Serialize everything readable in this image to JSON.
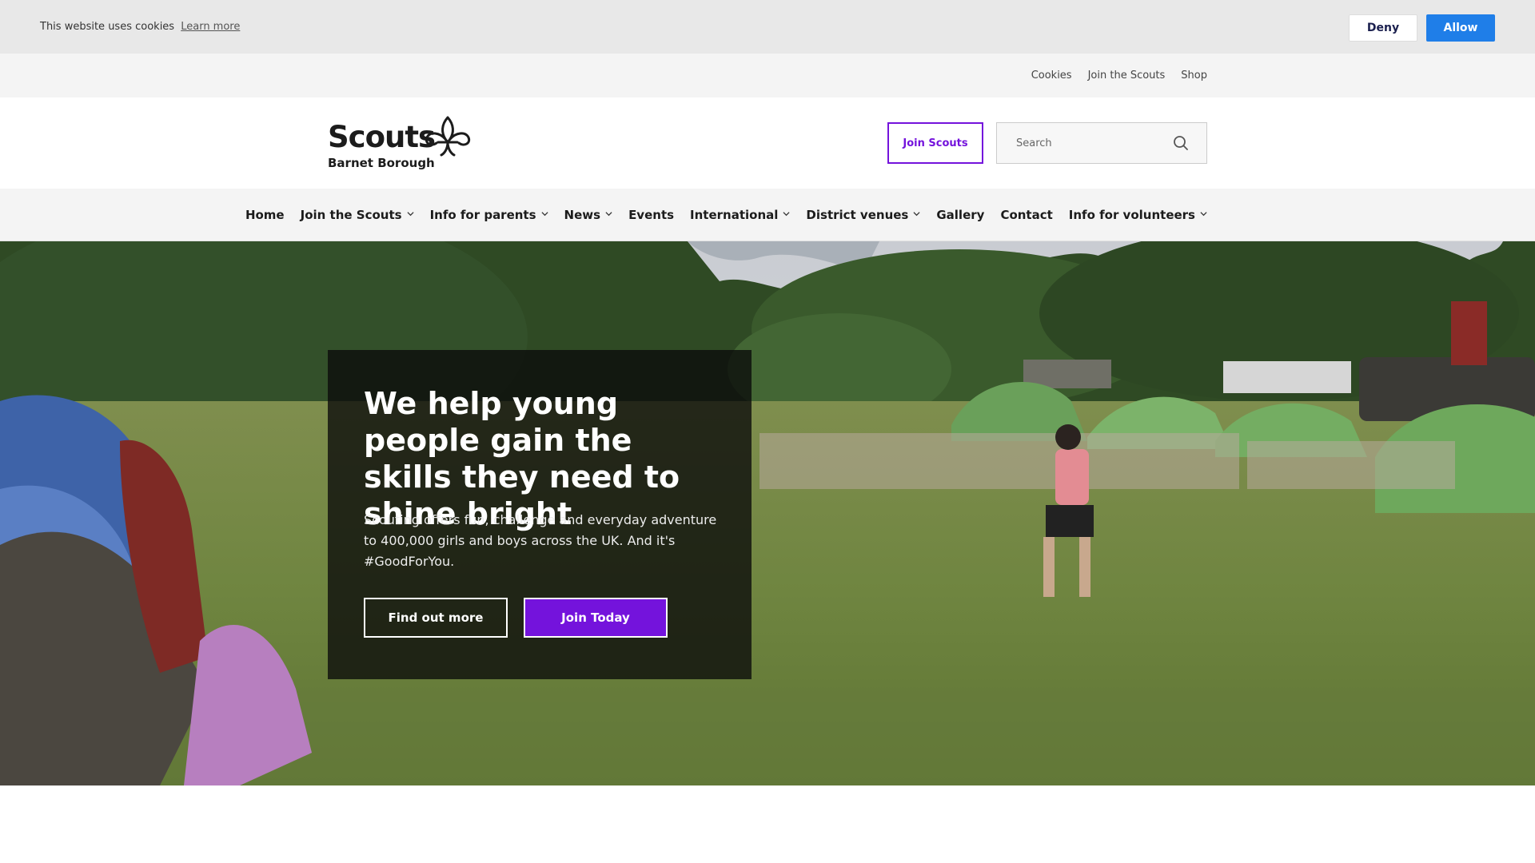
{
  "cookie_bar": {
    "message": "This website uses cookies",
    "learn_more": "Learn more",
    "deny": "Deny",
    "allow": "Allow"
  },
  "utility_links": [
    "Cookies",
    "Join the Scouts",
    "Shop"
  ],
  "header": {
    "logo_word": "Scouts",
    "logo_sub": "Barnet Borough",
    "join_button": "Join Scouts",
    "search_placeholder": "Search"
  },
  "nav": [
    {
      "label": "Home",
      "dropdown": false
    },
    {
      "label": "Join the Scouts",
      "dropdown": true
    },
    {
      "label": "Info for parents",
      "dropdown": true
    },
    {
      "label": "News",
      "dropdown": true
    },
    {
      "label": "Events",
      "dropdown": false
    },
    {
      "label": "International",
      "dropdown": true
    },
    {
      "label": "District venues",
      "dropdown": true
    },
    {
      "label": "Gallery",
      "dropdown": false
    },
    {
      "label": "Contact",
      "dropdown": false
    },
    {
      "label": "Info for volunteers",
      "dropdown": true
    }
  ],
  "hero": {
    "title": "We help young people gain the skills they need to shine bright",
    "text": "Scouting offers fun, challenge and everyday adventure to 400,000 girls and boys across the UK.  And it's #GoodForYou.",
    "find_out_more": "Find out more",
    "join_today": "Join Today"
  },
  "colors": {
    "brand_purple": "#7413dc",
    "allow_blue": "#1f7ee8"
  }
}
